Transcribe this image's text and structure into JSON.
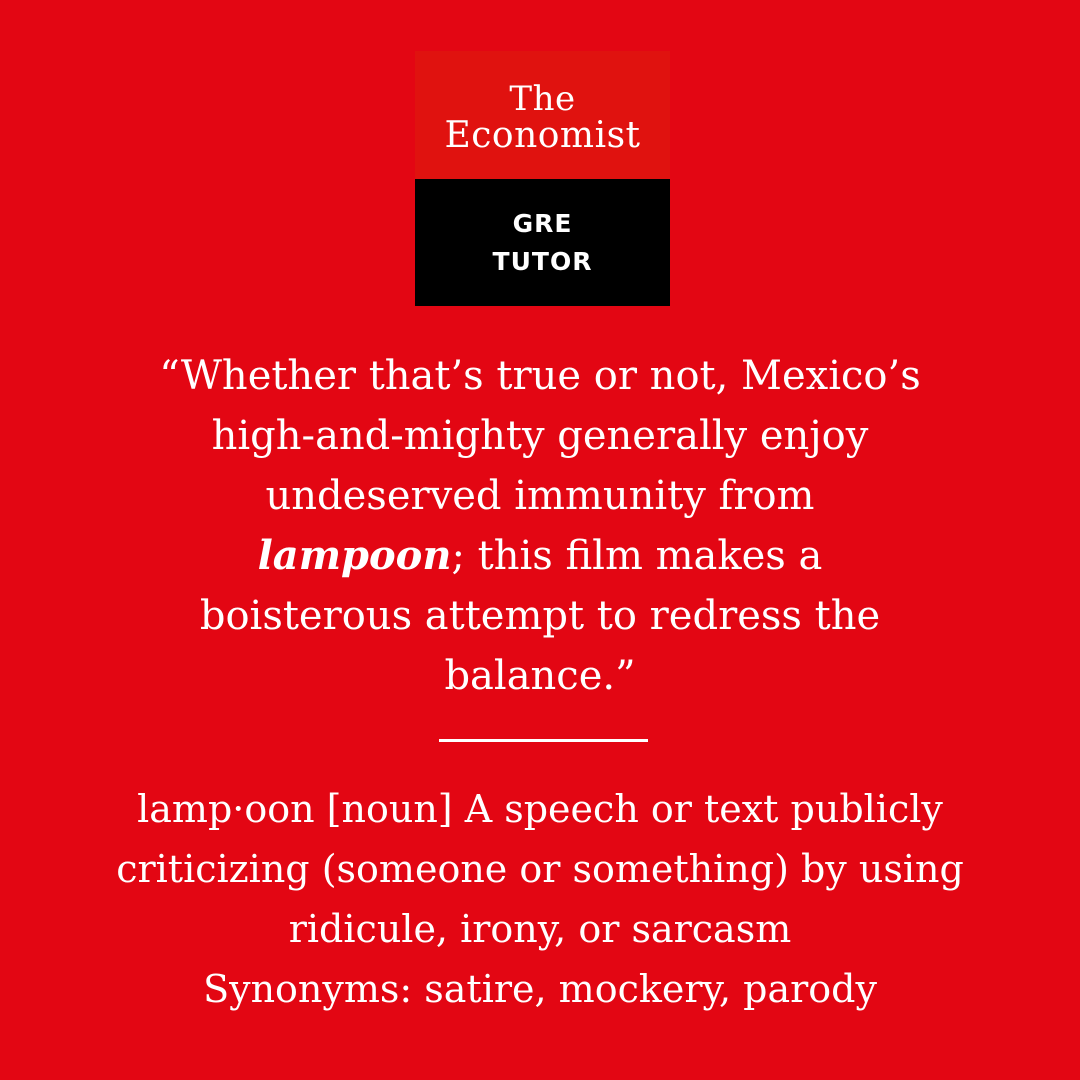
{
  "colors": {
    "background": "#E30613",
    "logo_top": "#E0120F",
    "logo_bottom": "#000000",
    "text": "#FFFFFF"
  },
  "logo": {
    "line1": "The",
    "line2": "Economist",
    "sub_line1": "GRE",
    "sub_line2": "TUTOR"
  },
  "quote": {
    "line1": "“Whether that’s true or not, Mexico’s",
    "line2": "high-and-mighty generally enjoy",
    "line3": "undeserved immunity from",
    "term": "lampoon",
    "line4_rest": "; this film makes a",
    "line5": "boisterous attempt to redress the",
    "line6": "balance.”"
  },
  "definition": {
    "line1": "lamp·oon [noun] A speech or text publicly",
    "line2": "criticizing (someone or something) by using",
    "line3": "ridicule, irony, or sarcasm",
    "synonyms": "Synonyms: satire, mockery, parody"
  }
}
